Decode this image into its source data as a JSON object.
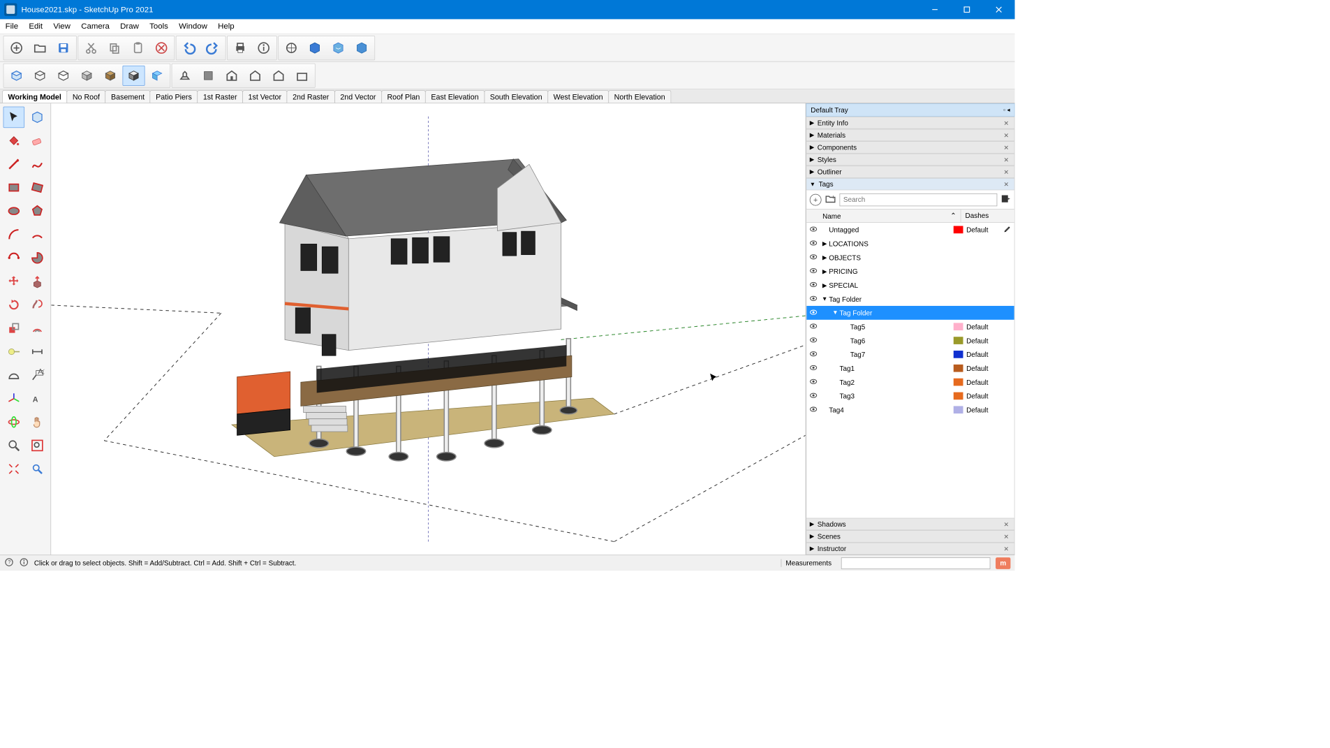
{
  "window": {
    "title": "House2021.skp - SketchUp Pro 2021"
  },
  "menu": [
    "File",
    "Edit",
    "View",
    "Camera",
    "Draw",
    "Tools",
    "Window",
    "Help"
  ],
  "scenes": [
    "Working Model",
    "No Roof",
    "Basement",
    "Patio Piers",
    "1st Raster",
    "1st Vector",
    "2nd Raster",
    "2nd Vector",
    "Roof Plan",
    "East Elevation",
    "South Elevation",
    "West Elevation",
    "North Elevation"
  ],
  "active_scene": 0,
  "tray": {
    "title": "Default Tray",
    "panels_collapsed_top": [
      "Entity Info",
      "Materials",
      "Components",
      "Styles",
      "Outliner"
    ],
    "tags_panel": "Tags",
    "panels_collapsed_bottom": [
      "Shadows",
      "Scenes",
      "Instructor"
    ]
  },
  "tags": {
    "search_placeholder": "Search",
    "col_name": "Name",
    "col_dashes": "Dashes",
    "rows": [
      {
        "eye": true,
        "indent": 0,
        "arrow": "",
        "name": "Untagged",
        "color": "#ff0000",
        "dash": "Default",
        "pencil": true
      },
      {
        "eye": true,
        "indent": 0,
        "arrow": "▶",
        "name": "LOCATIONS",
        "color": "",
        "dash": ""
      },
      {
        "eye": true,
        "indent": 0,
        "arrow": "▶",
        "name": "OBJECTS",
        "color": "",
        "dash": ""
      },
      {
        "eye": true,
        "indent": 0,
        "arrow": "▶",
        "name": "PRICING",
        "color": "",
        "dash": ""
      },
      {
        "eye": true,
        "indent": 0,
        "arrow": "▶",
        "name": "SPECIAL",
        "color": "",
        "dash": ""
      },
      {
        "eye": true,
        "indent": 0,
        "arrow": "▼",
        "name": "Tag Folder",
        "color": "",
        "dash": ""
      },
      {
        "eye": true,
        "indent": 1,
        "arrow": "▼",
        "name": "Tag Folder",
        "color": "",
        "dash": "",
        "selected": true
      },
      {
        "eye": true,
        "indent": 2,
        "arrow": "",
        "name": "Tag5",
        "color": "#ffb0cb",
        "dash": "Default"
      },
      {
        "eye": true,
        "indent": 2,
        "arrow": "",
        "name": "Tag6",
        "color": "#9a9a2a",
        "dash": "Default"
      },
      {
        "eye": true,
        "indent": 2,
        "arrow": "",
        "name": "Tag7",
        "color": "#1030d0",
        "dash": "Default"
      },
      {
        "eye": true,
        "indent": 1,
        "arrow": "",
        "name": "Tag1",
        "color": "#b85c1e",
        "dash": "Default"
      },
      {
        "eye": true,
        "indent": 1,
        "arrow": "",
        "name": "Tag2",
        "color": "#e66a1e",
        "dash": "Default"
      },
      {
        "eye": true,
        "indent": 1,
        "arrow": "",
        "name": "Tag3",
        "color": "#e66a1e",
        "dash": "Default"
      },
      {
        "eye": true,
        "indent": 0,
        "arrow": "",
        "name": "Tag4",
        "color": "#b0b0e6",
        "dash": "Default"
      }
    ]
  },
  "status": {
    "hint": "Click or drag to select objects. Shift = Add/Subtract. Ctrl = Add. Shift + Ctrl = Subtract.",
    "measurements_label": "Measurements"
  }
}
